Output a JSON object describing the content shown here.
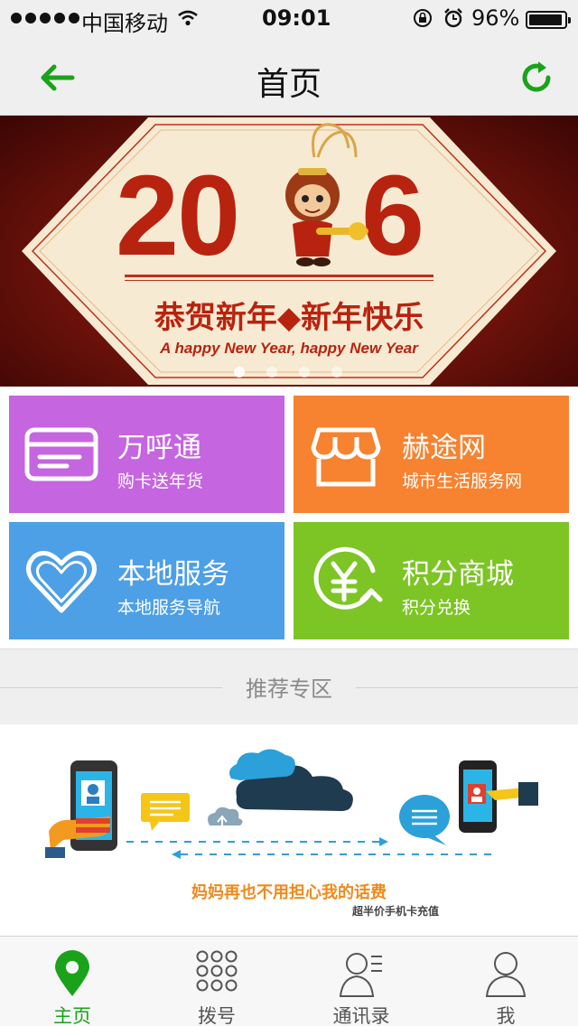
{
  "status_bar": {
    "carrier": "中国移动",
    "time": "09:01",
    "battery": "96%",
    "battery_level": 0.96
  },
  "nav": {
    "title": "首页",
    "accent_color": "#1aa31a"
  },
  "banner": {
    "year_left": "20",
    "year_right": "6",
    "greeting": "恭贺新年◆新年快乐",
    "subtitle": "A happy New Year, happy New Year",
    "slide_count": 4,
    "active_slide": 0
  },
  "tiles": [
    {
      "title": "万呼通",
      "subtitle": "购卡送年货",
      "icon": "card-icon",
      "color": "#c565e0"
    },
    {
      "title": "赫途网",
      "subtitle": "城市生活服务网",
      "icon": "shop-icon",
      "color": "#f7822f"
    },
    {
      "title": "本地服务",
      "subtitle": "本地服务导航",
      "icon": "heart-icon",
      "color": "#4d9fe6"
    },
    {
      "title": "积分商城",
      "subtitle": "积分兑换",
      "icon": "yen-exchange-icon",
      "color": "#7cc525"
    }
  ],
  "section": {
    "label": "推荐专区"
  },
  "promo": {
    "headline": "妈妈再也不用担心我的话费",
    "subline": "超半价手机卡充值"
  },
  "tab_bar": {
    "items": [
      {
        "label": "主页",
        "icon": "location-pin-icon",
        "active": true
      },
      {
        "label": "拨号",
        "icon": "dialpad-icon",
        "active": false
      },
      {
        "label": "通讯录",
        "icon": "contacts-icon",
        "active": false
      },
      {
        "label": "我",
        "icon": "person-icon",
        "active": false
      }
    ]
  }
}
